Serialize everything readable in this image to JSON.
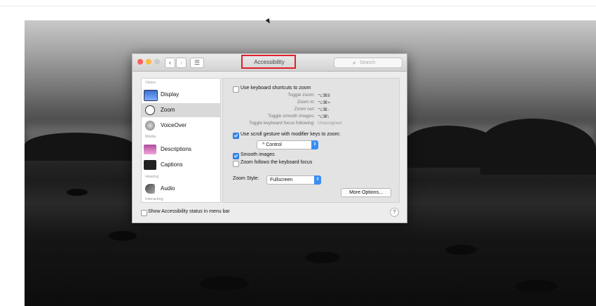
{
  "window": {
    "title": "Accessibility",
    "search_placeholder": "Search",
    "nav_back": "‹",
    "nav_forward": "›",
    "grid": "☰"
  },
  "sidebar": {
    "categories": [
      "Vision",
      "Media",
      "Hearing",
      "Interacting"
    ],
    "items": [
      {
        "label": "Display",
        "icon": "display-icon"
      },
      {
        "label": "Zoom",
        "icon": "zoom-icon"
      },
      {
        "label": "VoiceOver",
        "icon": "voiceover-icon"
      },
      {
        "label": "Descriptions",
        "icon": "descriptions-icon"
      },
      {
        "label": "Captions",
        "icon": "captions-icon"
      },
      {
        "label": "Audio",
        "icon": "audio-icon"
      }
    ],
    "selected": "Zoom"
  },
  "zoom": {
    "keyboard_shortcuts_label": "Use keyboard shortcuts to zoom",
    "shortcuts": [
      {
        "label": "Toggle zoom:",
        "key": "⌥⌘8"
      },
      {
        "label": "Zoom in:",
        "key": "⌥⌘="
      },
      {
        "label": "Zoom out:",
        "key": "⌥⌘-"
      },
      {
        "label": "Toggle smooth images:",
        "key": "⌥⌘\\"
      },
      {
        "label": "Toggle keyboard focus following:",
        "key": "Unassigned"
      }
    ],
    "scroll_gesture_label": "Use scroll gesture with modifier keys to zoom:",
    "modifier_value": "^ Control",
    "smooth_images_label": "Smooth images",
    "follow_focus_label": "Zoom follows the keyboard focus",
    "zoom_style_label": "Zoom Style:",
    "zoom_style_value": "Fullscreen",
    "more_options_label": "More Options..."
  },
  "footer": {
    "status_label": "Show Accessibility status in menu bar",
    "help": "?"
  },
  "colors": {
    "accent": "#3b8ef0",
    "highlight": "#e0202a",
    "close": "#fc605b",
    "minimize": "#fdbc40",
    "zoom": "#34c84a"
  }
}
